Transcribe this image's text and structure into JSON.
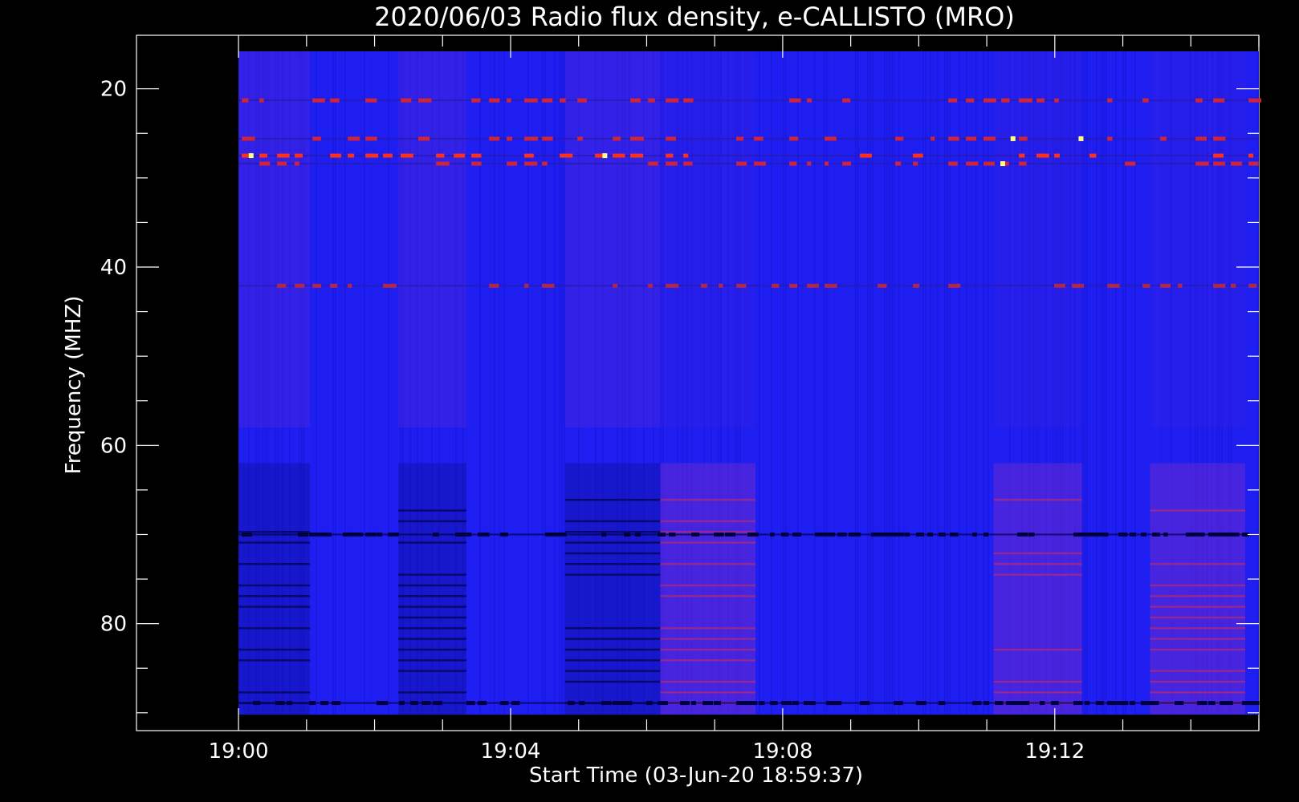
{
  "chart_data": {
    "type": "heatmap",
    "title": "2020/06/03  Radio flux density, e-CALLISTO (MRO)",
    "xlabel": "Start Time (03-Jun-20 18:59:37)",
    "ylabel": "Frequency (MHZ)",
    "x_axis": {
      "unit": "minutes after 19:00",
      "range": [
        -1.5,
        15.0
      ],
      "data_range": [
        0.0,
        15.0
      ],
      "major_ticks": [
        {
          "value": 0,
          "label": "19:00"
        },
        {
          "value": 4,
          "label": "19:04"
        },
        {
          "value": 8,
          "label": "19:08"
        },
        {
          "value": 12,
          "label": "19:12"
        }
      ],
      "minor_ticks": [
        1,
        2,
        3,
        5,
        6,
        7,
        9,
        10,
        11,
        13,
        14,
        15
      ]
    },
    "y_axis": {
      "unit": "MHz",
      "range": [
        14.0,
        92.0
      ],
      "data_range": [
        15.8,
        90.2
      ],
      "inverted": true,
      "major_ticks": [
        {
          "value": 20,
          "label": "20"
        },
        {
          "value": 40,
          "label": "40"
        },
        {
          "value": 60,
          "label": "60"
        },
        {
          "value": 80,
          "label": "80"
        }
      ],
      "minor_ticks": [
        25,
        30,
        35,
        45,
        50,
        55,
        65,
        70,
        75,
        85,
        90
      ]
    },
    "colormap": {
      "low": "#000000",
      "mid": "#1a1aff",
      "high": "#ff2020",
      "peak": "#ffff80"
    },
    "background_color": "#1e1ef0",
    "receiver_blocks": [
      {
        "t0": 0.0,
        "t1": 1.05
      },
      {
        "t0": 2.35,
        "t1": 3.35
      },
      {
        "t0": 4.8,
        "t1": 6.2
      },
      {
        "t0": 6.2,
        "t1": 7.6
      },
      {
        "t0": 11.1,
        "t1": 12.4
      },
      {
        "t0": 13.4,
        "t1": 14.8
      }
    ],
    "emission_lines": [
      {
        "freq": 21.3,
        "intensity": "medium"
      },
      {
        "freq": 25.6,
        "intensity": "medium"
      },
      {
        "freq": 27.5,
        "intensity": "strong"
      },
      {
        "freq": 28.4,
        "intensity": "medium"
      },
      {
        "freq": 42.1,
        "intensity": "weak"
      },
      {
        "freq": 70.0,
        "intensity": "dark"
      },
      {
        "freq": 88.9,
        "intensity": "dark"
      }
    ]
  }
}
